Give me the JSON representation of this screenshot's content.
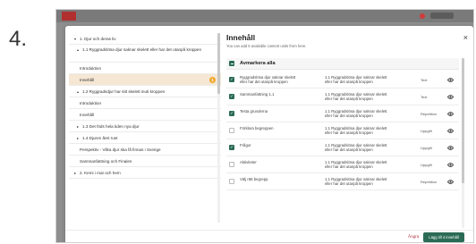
{
  "step_number": "4.",
  "modal": {
    "close_label": "×",
    "nav": {
      "items": [
        {
          "label": "1. Djur och deras liv",
          "arrow": "▾",
          "class": "nav-item",
          "badge": ""
        },
        {
          "label": "1.1 Ryggradslösa djur saknar skelett eller har det utanpå kroppen",
          "arrow": "▴",
          "class": "nav-item lvl1 two-line",
          "badge": ""
        },
        {
          "label": "Introduktion",
          "arrow": "",
          "class": "nav-item leaf",
          "badge": ""
        },
        {
          "label": "Innehåll",
          "arrow": "",
          "class": "nav-item leaf active",
          "badge": "1"
        },
        {
          "label": "1.2 Ryggradsdjur har sitt skelett inuti kroppen",
          "arrow": "▴",
          "class": "nav-item lvl1",
          "badge": ""
        },
        {
          "label": "Introduktion",
          "arrow": "",
          "class": "nav-item leaf",
          "badge": ""
        },
        {
          "label": "Innehåll",
          "arrow": "",
          "class": "nav-item leaf",
          "badge": ""
        },
        {
          "label": "1.3 Det föds hela tiden nya djur",
          "arrow": "▸",
          "class": "nav-item lvl1",
          "badge": ""
        },
        {
          "label": "1.4 Djuren året runt",
          "arrow": "▸",
          "class": "nav-item lvl1",
          "badge": ""
        },
        {
          "label": "Perspektiv - Vilka djur ska få finnas i Sverige",
          "arrow": "",
          "class": "nav-item leaf",
          "badge": ""
        },
        {
          "label": "Sammanfattning och Finalen",
          "arrow": "",
          "class": "nav-item leaf",
          "badge": ""
        },
        {
          "label": "2. Kemi i mat och hem",
          "arrow": "▸",
          "class": "nav-item",
          "badge": ""
        }
      ]
    },
    "content": {
      "title": "Innehåll",
      "subtitle": "You can add 5 available content units from here.",
      "select_all_label": "Avmarkera alla",
      "rows": [
        {
          "title": "Ryggradslösa djur saknar skelett eller har det utanpå kroppen",
          "ref": "1.1 Ryggradslösa djur saknar skelett eller har det utanpå kroppen",
          "type": "Text",
          "checked": "true"
        },
        {
          "title": "Sammanfattning 1.1",
          "ref": "1.1 Ryggradslösa djur saknar skelett eller har det utanpå kroppen",
          "type": "Text",
          "checked": "true"
        },
        {
          "title": "Testa grunderna",
          "ref": "1.1 Ryggradslösa djur saknar skelett eller har det utanpå kroppen",
          "type": "Repetition",
          "checked": "true"
        },
        {
          "title": "Förklara begreppen",
          "ref": "1.1 Ryggradslösa djur saknar skelett eller har det utanpå kroppen",
          "type": "Uppgift",
          "checked": "false"
        },
        {
          "title": "Frågor",
          "ref": "1.1 Ryggradslösa djur saknar skelett eller har det utanpå kroppen",
          "type": "Uppgift",
          "checked": "true"
        },
        {
          "title": "Aktiviteter",
          "ref": "1.1 Ryggradslösa djur saknar skelett eller har det utanpå kroppen",
          "type": "Uppgift",
          "checked": "false"
        },
        {
          "title": "Välj rätt begrepp",
          "ref": "1.1 Ryggradslösa djur saknar skelett eller har det utanpå kroppen",
          "type": "Repetition",
          "checked": "false"
        }
      ]
    },
    "footer": {
      "cancel_label": "Ångra",
      "add_label": "Lägg till 4 innehåll"
    }
  },
  "colors": {
    "accent": "#2b6b55",
    "active_bg": "#f5e7d4",
    "badge": "#f0a830",
    "cancel": "#b0303f"
  },
  "icons": {
    "eye": "eye-icon",
    "close": "close-icon",
    "check": "checkmark-icon"
  }
}
